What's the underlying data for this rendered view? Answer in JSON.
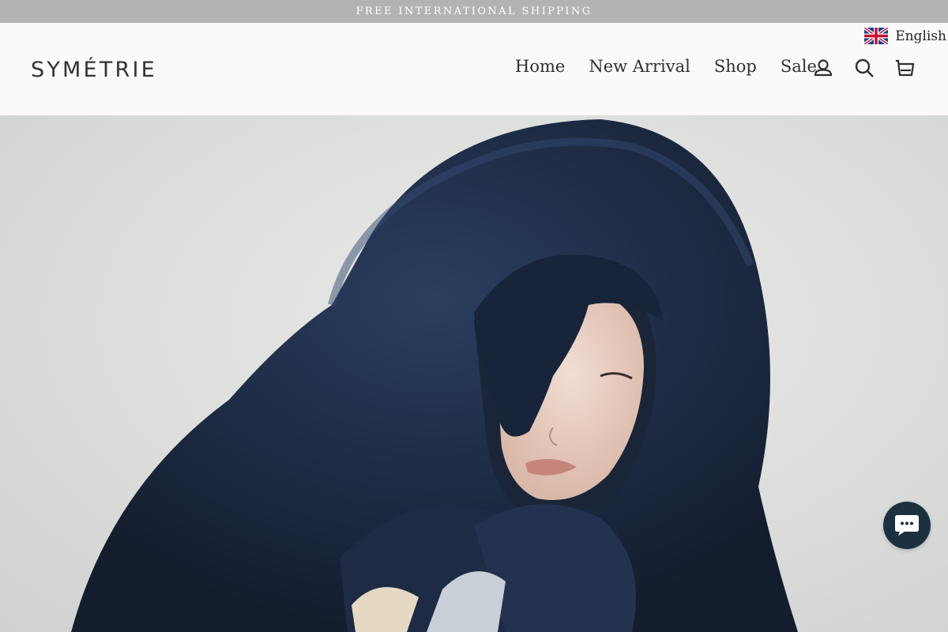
{
  "announcement": {
    "text": "FREE INTERNATIONAL SHIPPING"
  },
  "header": {
    "logo": "SYMÉTRIE",
    "nav": [
      {
        "label": "Home"
      },
      {
        "label": "New Arrival"
      },
      {
        "label": "Shop"
      },
      {
        "label": "Sale"
      }
    ],
    "icons": [
      "account-icon",
      "search-icon",
      "cart-icon"
    ],
    "language": {
      "label": "English",
      "flag": "uk-flag-icon"
    }
  },
  "hero": {
    "image": "model in navy hooded fur coat",
    "colors": {
      "background": "#dcdedc",
      "fur": "#1f2c44"
    }
  },
  "chat": {
    "icon": "chat-icon",
    "color": "#1b3140"
  }
}
